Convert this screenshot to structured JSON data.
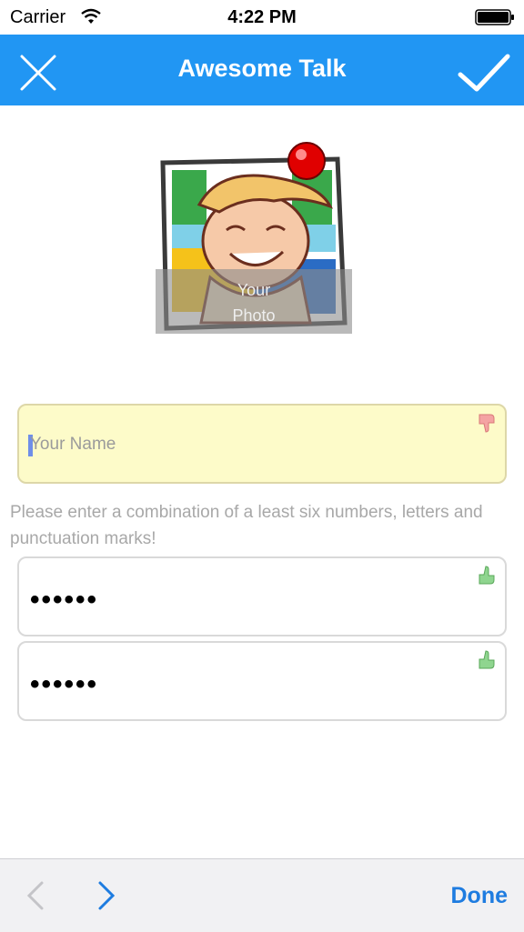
{
  "status_bar": {
    "carrier": "Carrier",
    "time": "4:22 PM"
  },
  "nav": {
    "title": "Awesome Talk",
    "close_icon": "close-icon",
    "confirm_icon": "checkmark-icon",
    "color": "#2196F3"
  },
  "photo": {
    "label_line1": "Your",
    "label_line2": "Photo",
    "badge_color": "#e00000"
  },
  "form": {
    "name": {
      "placeholder": "Your Name",
      "value": "",
      "status_icon": "thumbs-down-icon"
    },
    "hint": "Please enter a combination of a least six numbers, letters and punctuation marks!",
    "password": {
      "masked": "••••••",
      "status_icon": "thumbs-up-icon"
    },
    "password_confirm": {
      "masked": "••••••",
      "status_icon": "thumbs-up-icon"
    }
  },
  "toolbar": {
    "done_label": "Done",
    "prev_icon": "chevron-left-icon",
    "next_icon": "chevron-right-icon",
    "accent": "#1e7ce0"
  }
}
